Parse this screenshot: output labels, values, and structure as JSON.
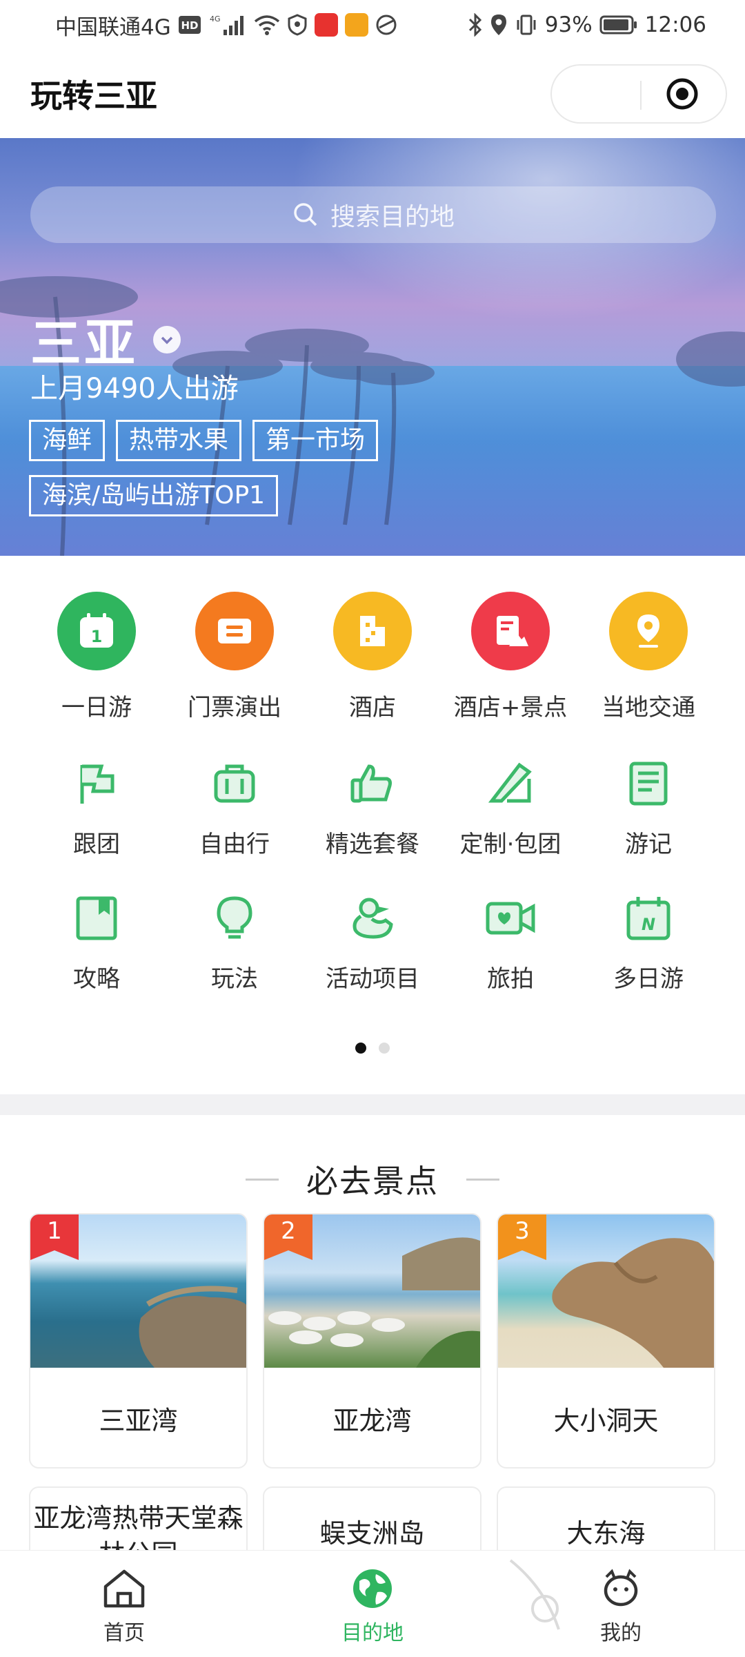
{
  "status_bar": {
    "carrier": "中国联通4G",
    "network_badge": "HD",
    "signal": "4G",
    "battery": "93%",
    "time": "12:06",
    "icons": [
      "hd-icon",
      "signal-icon",
      "wifi-icon",
      "vpn-icon",
      "weibo-icon",
      "app-icon",
      "app2-icon",
      "bluetooth-icon",
      "location-icon",
      "vibrate-icon",
      "battery-icon"
    ]
  },
  "header": {
    "title": "玩转三亚",
    "capsule_icons": [
      "more-icon",
      "target-icon"
    ]
  },
  "hero": {
    "search_placeholder": "搜索目的地",
    "city": "三亚",
    "visitors": "上月9490人出游",
    "tags": [
      "海鲜",
      "热带水果",
      "第一市场",
      "海滨/岛屿出游TOP1"
    ]
  },
  "categories": {
    "primary": [
      {
        "label": "一日游",
        "icon": "calendar-icon",
        "color": "#2fb55e"
      },
      {
        "label": "门票演出",
        "icon": "ticket-icon",
        "color": "#f47a1f"
      },
      {
        "label": "酒店",
        "icon": "hotel-icon",
        "color": "#f7b923"
      },
      {
        "label": "酒店+景点",
        "icon": "hotel-scenic-icon",
        "color": "#ef3b4a"
      },
      {
        "label": "当地交通",
        "icon": "location-pin-icon",
        "color": "#f7b923"
      }
    ],
    "secondary": [
      {
        "label": "跟团",
        "icon": "flag-icon"
      },
      {
        "label": "自由行",
        "icon": "luggage-icon"
      },
      {
        "label": "精选套餐",
        "icon": "thumbs-up-icon"
      },
      {
        "label": "定制·包团",
        "icon": "ruler-pen-icon"
      },
      {
        "label": "游记",
        "icon": "notes-icon"
      }
    ],
    "tertiary": [
      {
        "label": "攻略",
        "icon": "book-icon"
      },
      {
        "label": "玩法",
        "icon": "bulb-icon"
      },
      {
        "label": "活动项目",
        "icon": "duck-icon"
      },
      {
        "label": "旅拍",
        "icon": "video-camera-icon"
      },
      {
        "label": "多日游",
        "icon": "calendar-n-icon"
      }
    ],
    "line_icon_color": "#3cb96a",
    "pager": {
      "total": 2,
      "active": 1
    }
  },
  "must_see": {
    "title": "必去景点",
    "cards": [
      {
        "rank": "1",
        "name": "三亚湾",
        "rank_color": "#e8363a"
      },
      {
        "rank": "2",
        "name": "亚龙湾",
        "rank_color": "#f0662b"
      },
      {
        "rank": "3",
        "name": "大小洞天",
        "rank_color": "#f2921c"
      }
    ],
    "cards_more": [
      "亚龙湾热带天堂森林公园",
      "蜈支洲岛",
      "大东海"
    ]
  },
  "bottom_nav": {
    "items": [
      {
        "label": "首页",
        "icon": "home-icon",
        "active": false
      },
      {
        "label": "目的地",
        "icon": "globe-icon",
        "active": true
      },
      {
        "label": "我的",
        "icon": "profile-icon",
        "active": false
      }
    ],
    "active_color": "#2fb560"
  }
}
